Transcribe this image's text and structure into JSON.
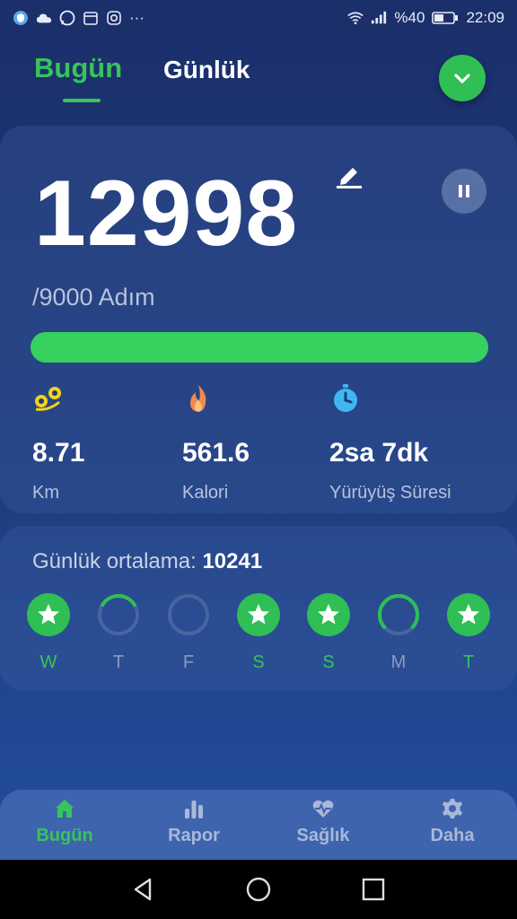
{
  "status_bar": {
    "battery": "%40",
    "time": "22:09",
    "overflow": "···"
  },
  "header": {
    "tabs": [
      {
        "label": "Bugün",
        "active": true
      },
      {
        "label": "Günlük",
        "active": false
      }
    ],
    "dropdown_icon": "chevron-down-icon"
  },
  "today": {
    "steps": "12998",
    "goal": "/9000 Adım",
    "progress_fraction": 1.0,
    "stats": [
      {
        "icon": "distance-icon",
        "value": "8.71",
        "label": "Km"
      },
      {
        "icon": "flame-icon",
        "value": "561.6",
        "label": "Kalori"
      },
      {
        "icon": "stopwatch-icon",
        "value": "2sa 7dk",
        "label": "Yürüyüş Süresi"
      }
    ]
  },
  "weekly": {
    "average_label": "Günlük ortalama:",
    "average_value": "10241",
    "days": [
      {
        "label": "W",
        "status": "complete",
        "progress": 1.0
      },
      {
        "label": "T",
        "status": "partial",
        "progress": 0.35
      },
      {
        "label": "F",
        "status": "empty",
        "progress": 0.0
      },
      {
        "label": "S",
        "status": "complete",
        "progress": 1.0
      },
      {
        "label": "S",
        "status": "complete",
        "progress": 1.0
      },
      {
        "label": "M",
        "status": "partial",
        "progress": 0.75
      },
      {
        "label": "T",
        "status": "complete",
        "progress": 1.0
      }
    ]
  },
  "bottom_nav": [
    {
      "label": "Bugün",
      "icon": "home-icon",
      "active": true
    },
    {
      "label": "Rapor",
      "icon": "bar-chart-icon",
      "active": false
    },
    {
      "label": "Sağlık",
      "icon": "heart-pulse-icon",
      "active": false
    },
    {
      "label": "Daha",
      "icon": "gear-icon",
      "active": false
    }
  ],
  "colors": {
    "accent": "#37c45a",
    "muted": "#b8c3dc",
    "background": "#1d3a7a"
  }
}
